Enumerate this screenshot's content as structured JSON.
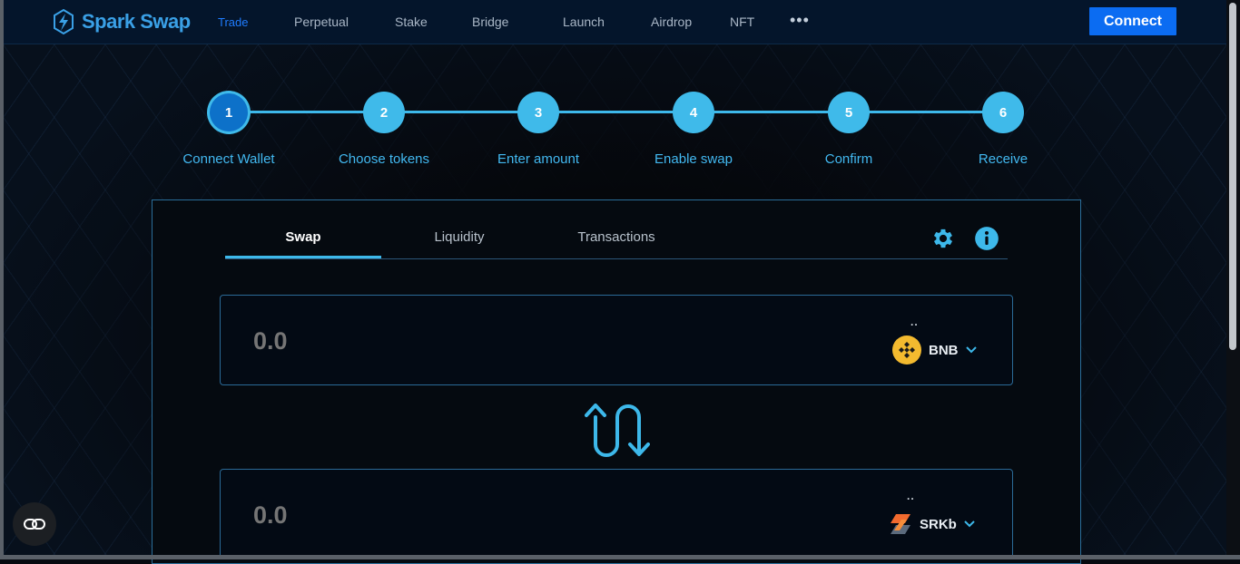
{
  "nav": {
    "brand": "Spark Swap",
    "brand_part1": "Spark",
    "brand_part2": "Swap",
    "items": [
      {
        "label": "Trade",
        "active": true
      },
      {
        "label": "Perpetual"
      },
      {
        "label": "Stake"
      },
      {
        "label": "Bridge"
      },
      {
        "label": "Launch"
      },
      {
        "label": "Airdrop"
      },
      {
        "label": "NFT"
      }
    ],
    "more": "•••",
    "connect_label": "Connect"
  },
  "steps": [
    {
      "number": "1",
      "label": "Connect Wallet"
    },
    {
      "number": "2",
      "label": "Choose tokens"
    },
    {
      "number": "3",
      "label": "Enter amount"
    },
    {
      "number": "4",
      "label": "Enable swap"
    },
    {
      "number": "5",
      "label": "Confirm"
    },
    {
      "number": "6",
      "label": "Receive"
    }
  ],
  "tabs": [
    {
      "label": "Swap"
    },
    {
      "label": "Liquidity"
    },
    {
      "label": "Transactions"
    }
  ],
  "from": {
    "amount": "0.0",
    "balance_dots": "..",
    "token": "BNB"
  },
  "to": {
    "amount": "0.0",
    "balance_dots": "..",
    "token": "SRKb"
  },
  "colors": {
    "accent": "#3db8ea",
    "brand": "#3aa0e6",
    "connect": "#0b6cf2",
    "bnb": "#f3ba2f",
    "srk": "#f26a2e"
  },
  "icons": {
    "settings": "gear-icon",
    "info": "info-icon",
    "swap": "swap-arrows-icon",
    "fab": "link-icon"
  }
}
